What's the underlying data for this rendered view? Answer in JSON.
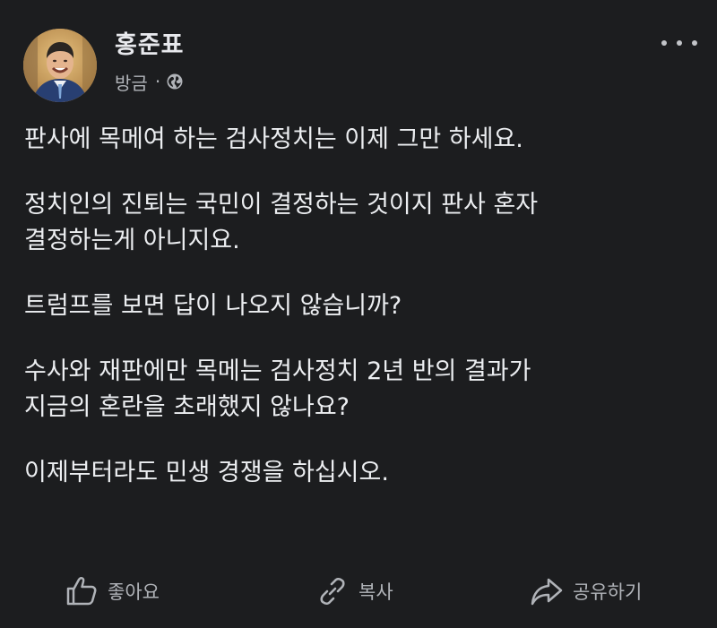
{
  "post": {
    "author": "홍준표",
    "time": "방금",
    "separator": "·",
    "privacy_icon": "globe-icon",
    "more_icon": "more-horizontal-icon",
    "paragraphs": [
      [
        "판사에 목메여 하는 검사정치는 이제 그만 하세요."
      ],
      [
        "정치인의 진퇴는 국민이 결정하는 것이지 판사 혼자",
        "결정하는게 아니지요."
      ],
      [
        "트럼프를 보면 답이 나오지 않습니까?"
      ],
      [
        "수사와 재판에만 목메는 검사정치 2년 반의 결과가",
        "지금의 혼란을 초래했지 않나요?"
      ],
      [
        "이제부터라도 민생 경쟁을 하십시오."
      ]
    ]
  },
  "actions": {
    "like": {
      "label": "좋아요",
      "icon": "thumbs-up-icon"
    },
    "copy": {
      "label": "복사",
      "icon": "link-icon"
    },
    "share": {
      "label": "공유하기",
      "icon": "share-icon"
    }
  },
  "colors": {
    "background": "#1c1d1f",
    "text": "#eceef1",
    "secondary_text": "#b0b3b8"
  }
}
